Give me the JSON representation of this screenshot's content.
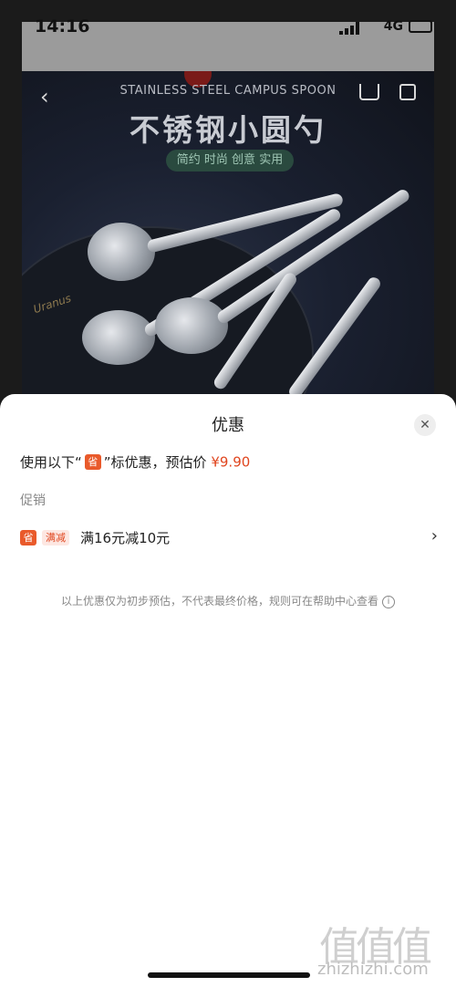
{
  "status_bar": {
    "time": "14:16",
    "network": "4G"
  },
  "product_banner": {
    "headline_en": "STAINLESS STEEL CAMPUS SPOON",
    "headline_cn": "不锈钢小圆勺",
    "tagline": "简约 时尚 创意 实用",
    "brand_mark": "Uranus"
  },
  "nav": {
    "back_glyph": "‹"
  },
  "sheet": {
    "title": "优惠",
    "close_glyph": "✕",
    "estimate_prefix": "使用以下“",
    "estimate_tag": "省",
    "estimate_suffix": "”标优惠，预估价",
    "estimate_price": "¥9.90",
    "section_label": "促销",
    "promo": {
      "tag": "省",
      "badge": "满减",
      "text": "满16元减10元",
      "arrow_glyph": "›"
    },
    "disclaimer": "以上优惠仅为初步预估，不代表最终价格，规则可在帮助中心查看",
    "info_glyph": "i"
  },
  "watermark": {
    "logo": "值值值",
    "url": "zhizhizhi.com"
  },
  "colors": {
    "accent": "#e0461f",
    "tag_bg": "#e95a2b",
    "badge_bg": "#fde7e2"
  }
}
